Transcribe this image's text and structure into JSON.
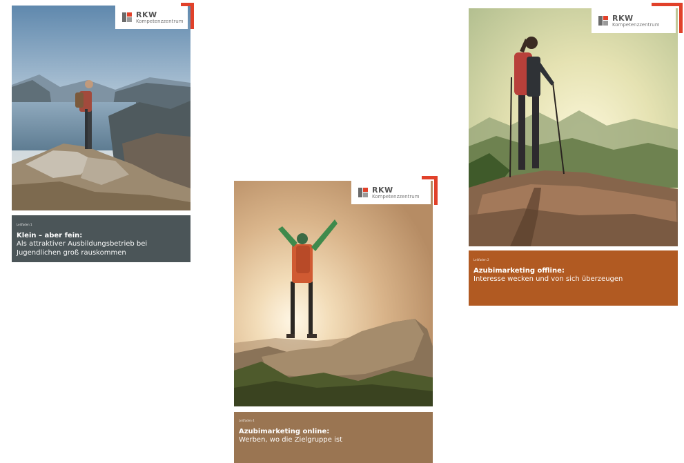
{
  "brand": {
    "name": "RKW",
    "tagline": "Kompetenzzentrum",
    "accent": "#e1412a"
  },
  "covers": [
    {
      "series": "Leitfaden 1",
      "title": "Klein – aber fein:",
      "subtitle": "Als attraktiver Ausbildungsbetrieb bei Jugendlichen groß rauskommen",
      "color": "#4b5558",
      "photo": "hiker-overlooking-lake-mountains"
    },
    {
      "series": "Leitfaden 4",
      "title": "Azubimarketing online:",
      "subtitle": "Werben, wo die Zielgruppe ist",
      "color": "#9a7552",
      "photo": "hiker-arms-raised-on-rock-at-sunset"
    },
    {
      "series": "Leitfaden 2",
      "title": "Azubimarketing offline:",
      "subtitle": "Interesse wecken und von sich überzeugen",
      "color": "#b15a22",
      "photo": "hiker-with-poles-on-summit"
    }
  ]
}
